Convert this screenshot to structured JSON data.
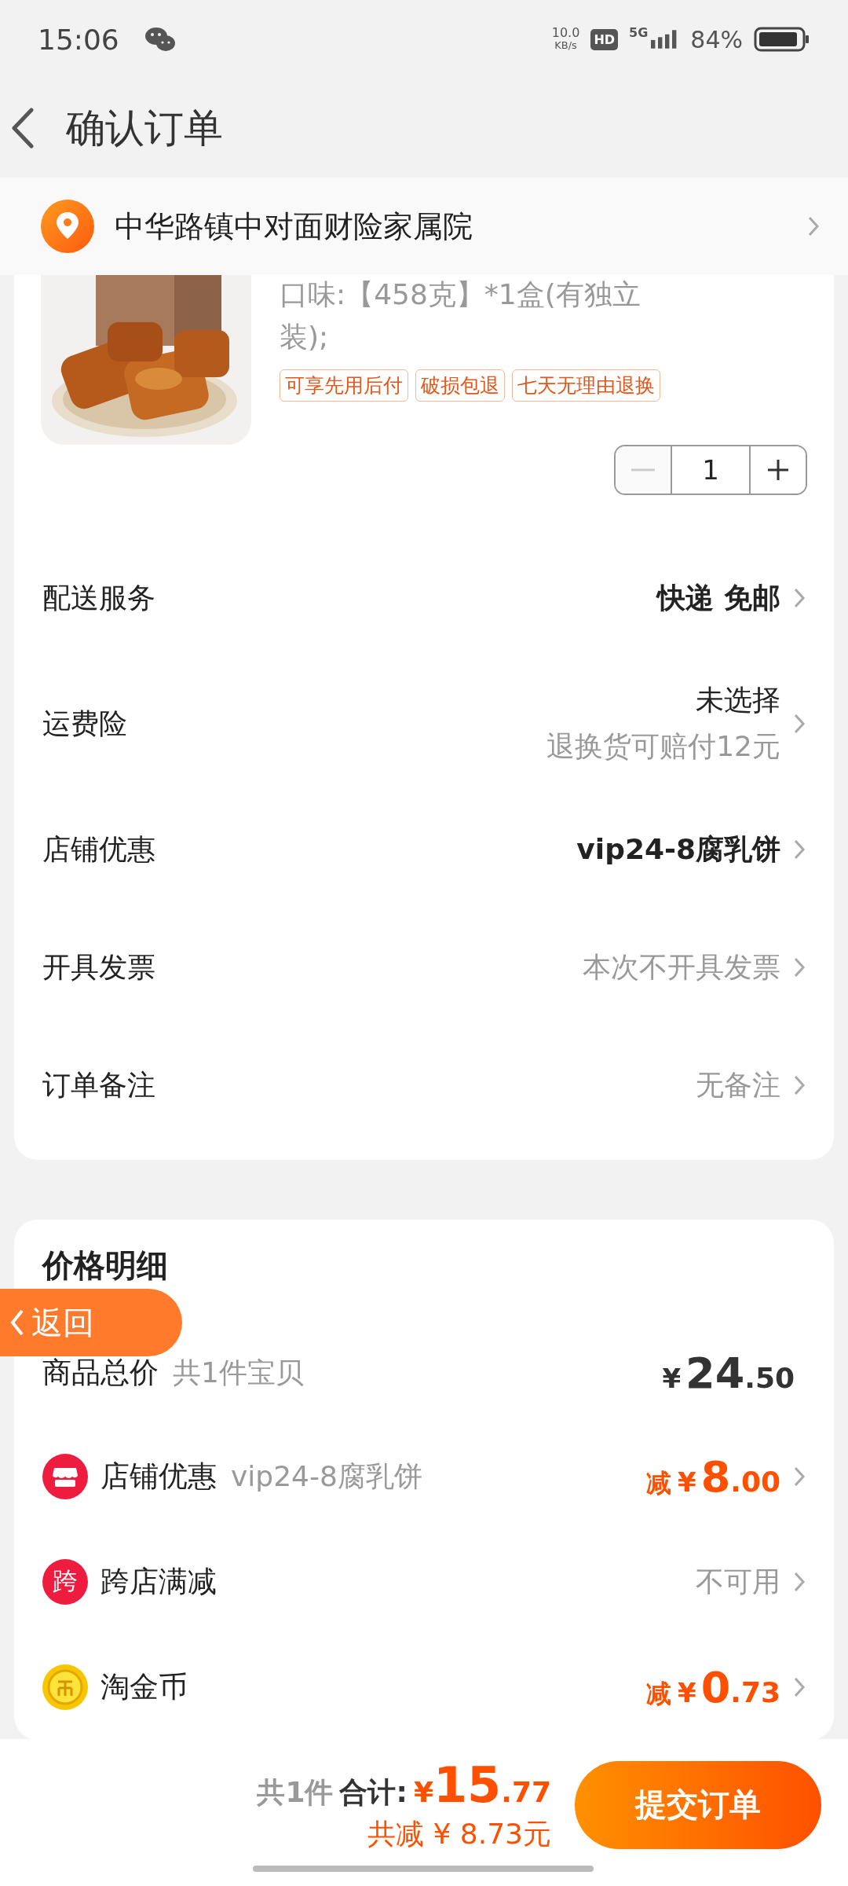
{
  "status_bar": {
    "time": "15:06",
    "speed_value": "10.0",
    "speed_unit": "KB/s",
    "hd": "HD",
    "network": "5G",
    "battery": "84%"
  },
  "header": {
    "title": "确认订单"
  },
  "address": {
    "text": "中华路镇中对面财险家属院"
  },
  "product": {
    "kind": "picture",
    "option": "口味:【458克】*1盒(有独立装);",
    "tags": [
      "可享先用后付",
      "破损包退",
      "七天无理由退换"
    ],
    "quantity": "1",
    "minus_disabled": true
  },
  "order_options": [
    {
      "label": "配送服务",
      "value": "快递 免邮",
      "muted": false,
      "bold": true
    },
    {
      "label": "运费险",
      "value": "未选择",
      "note": "退换货可赔付12元",
      "muted": false,
      "bold": false
    },
    {
      "label": "店铺优惠",
      "value": "vip24-8腐乳饼",
      "muted": false,
      "bold": true
    },
    {
      "label": "开具发票",
      "value": "本次不开具发票",
      "muted": true,
      "bold": false
    },
    {
      "label": "订单备注",
      "value": "无备注",
      "muted": true,
      "bold": false
    }
  ],
  "price_details": {
    "title": "价格明细",
    "rows": [
      {
        "kind": "total",
        "label": "商品总价",
        "sub": "共1件宝贝",
        "currency": "¥",
        "integer": "24",
        "decimal": ".50"
      },
      {
        "kind": "discount",
        "label": "店铺优惠",
        "sub": "vip24-8腐乳饼",
        "prefix": "减",
        "currency": "¥",
        "integer": "8",
        "decimal": ".00"
      },
      {
        "kind": "text",
        "icon_text": "跨",
        "label": "跨店满减",
        "value": "不可用"
      },
      {
        "kind": "discount",
        "label": "淘金币",
        "prefix": "减",
        "currency": "¥",
        "integer": "0",
        "decimal": ".73"
      }
    ]
  },
  "float_button": {
    "label": "返回"
  },
  "bottom_bar": {
    "count": "共1件",
    "total_label": "合计:",
    "currency": "¥",
    "integer": "15",
    "decimal": ".77",
    "saving": "共减 ¥ 8.73元",
    "submit": "提交订单"
  }
}
